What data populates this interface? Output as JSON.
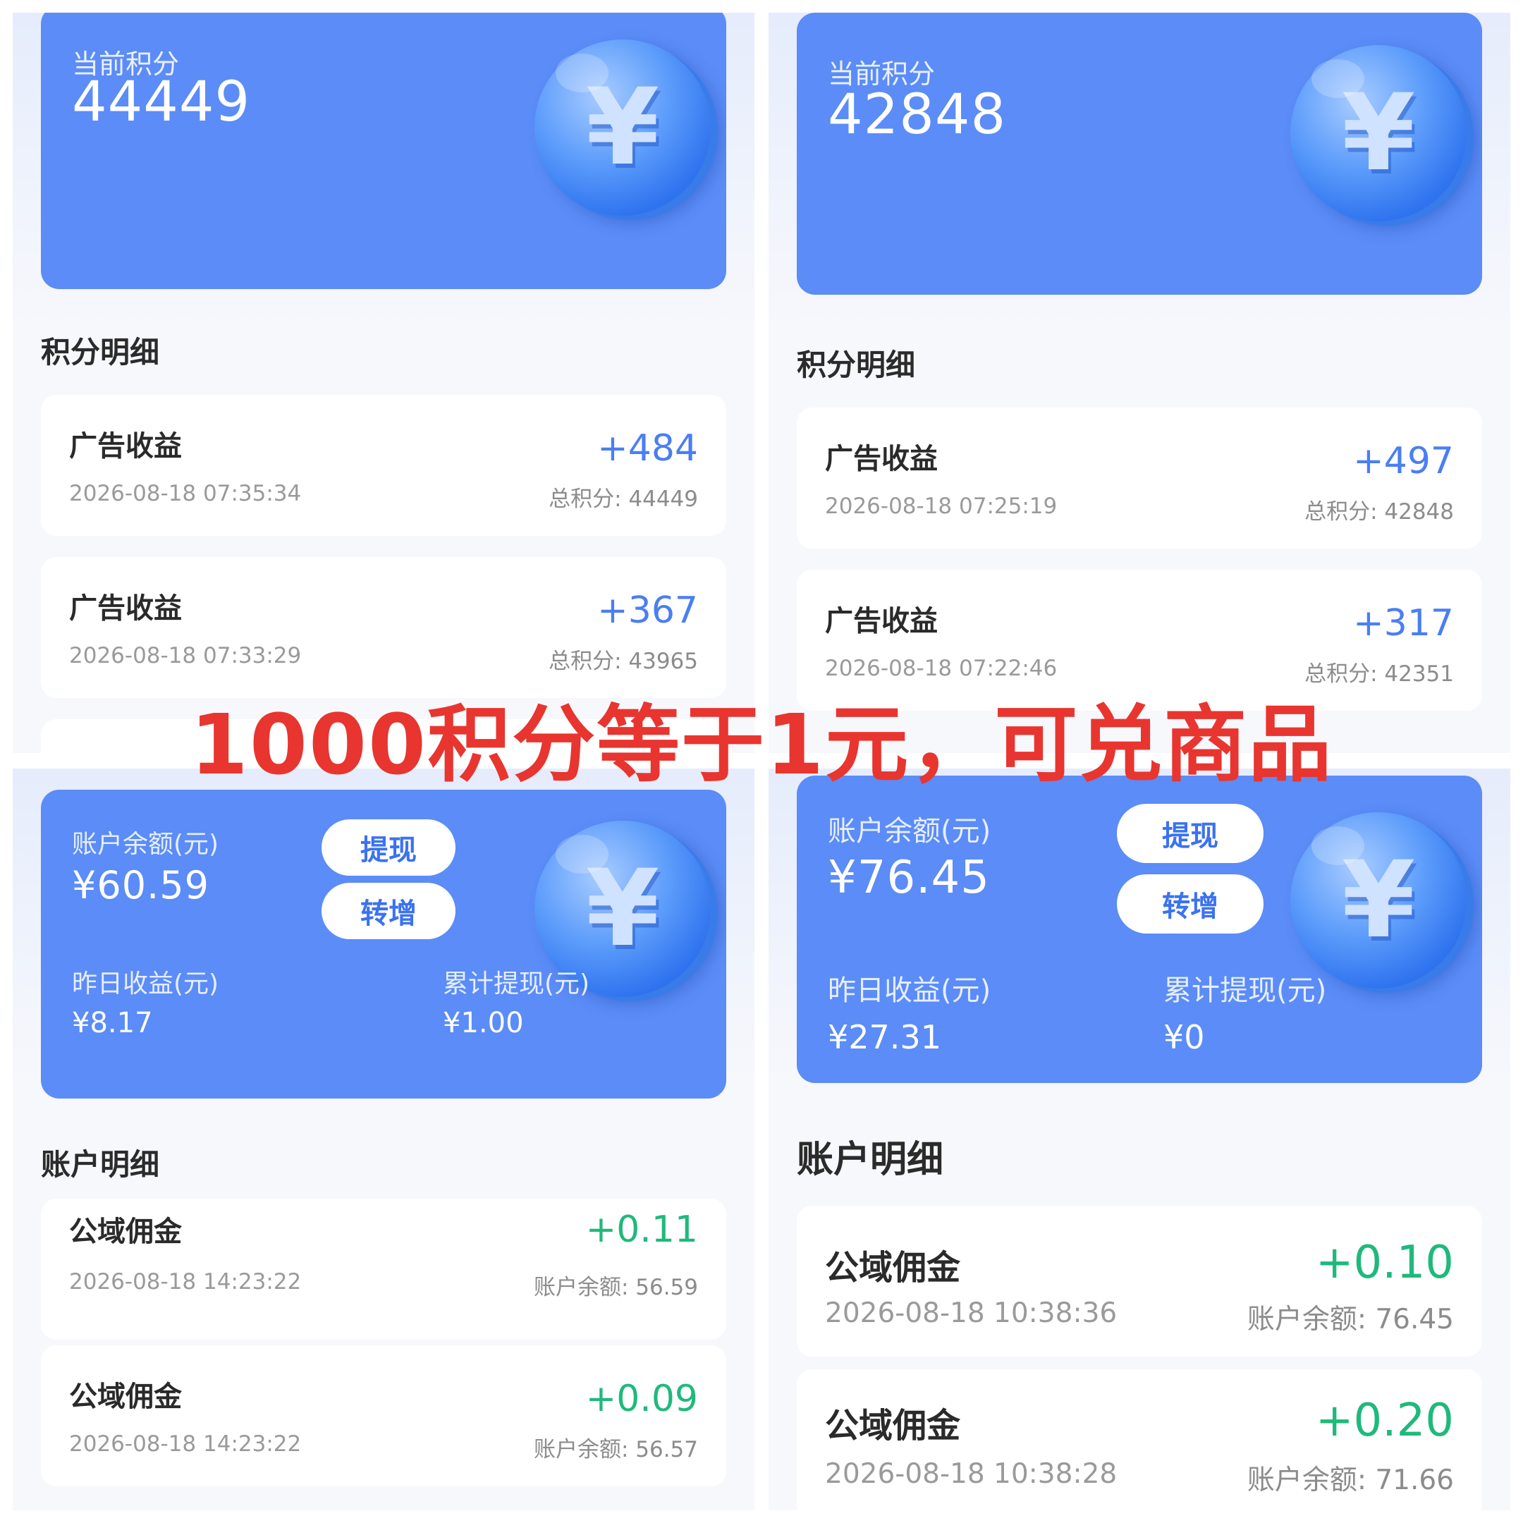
{
  "top_left": {
    "card_label": "当前积分",
    "card_value": "44449",
    "section_title": "积分明细",
    "items": [
      {
        "title": "广告收益",
        "date": "2026-08-18 07:35:34",
        "amount": "+484",
        "total": "总积分: 44449"
      },
      {
        "title": "广告收益",
        "date": "2026-08-18 07:33:29",
        "amount": "+367",
        "total": "总积分: 43965"
      }
    ]
  },
  "top_right": {
    "card_label": "当前积分",
    "card_value": "42848",
    "section_title": "积分明细",
    "items": [
      {
        "title": "广告收益",
        "date": "2026-08-18 07:25:19",
        "amount": "+497",
        "total": "总积分: 42848"
      },
      {
        "title": "广告收益",
        "date": "2026-08-18 07:22:46",
        "amount": "+317",
        "total": "总积分: 42351"
      }
    ]
  },
  "bottom_left": {
    "balance_label": "账户余额(元)",
    "balance_value": "¥60.59",
    "withdraw_button": "提现",
    "transfer_button": "转增",
    "yesterday_label": "昨日收益(元)",
    "yesterday_value": "¥8.17",
    "cumulative_label": "累计提现(元)",
    "cumulative_value": "¥1.00",
    "section_title": "账户明细",
    "items": [
      {
        "title": "公域佣金",
        "date": "2026-08-18 14:23:22",
        "amount": "+0.11",
        "balance": "账户余额: 56.59"
      },
      {
        "title": "公域佣金",
        "date": "2026-08-18 14:23:22",
        "amount": "+0.09",
        "balance": "账户余额: 56.57"
      }
    ]
  },
  "bottom_right": {
    "balance_label": "账户余额(元)",
    "balance_value": "¥76.45",
    "withdraw_button": "提现",
    "transfer_button": "转增",
    "yesterday_label": "昨日收益(元)",
    "yesterday_value": "¥27.31",
    "cumulative_label": "累计提现(元)",
    "cumulative_value": "¥0",
    "section_title": "账户明细",
    "items": [
      {
        "title": "公域佣金",
        "date": "2026-08-18 10:38:36",
        "amount": "+0.10",
        "balance": "账户余额: 76.45"
      },
      {
        "title": "公域佣金",
        "date": "2026-08-18 10:38:28",
        "amount": "+0.20",
        "balance": "账户余额: 71.66"
      }
    ]
  },
  "banner_text": "1000积分等于1元，可兑商品",
  "coin_symbol": "¥",
  "icons": [
    "yuan-coin-icon"
  ],
  "colors": {
    "card": "#5b8cf7",
    "points_amount": "#4a7ef2",
    "money_amount": "#1fb97c",
    "banner": "#e8352f"
  }
}
